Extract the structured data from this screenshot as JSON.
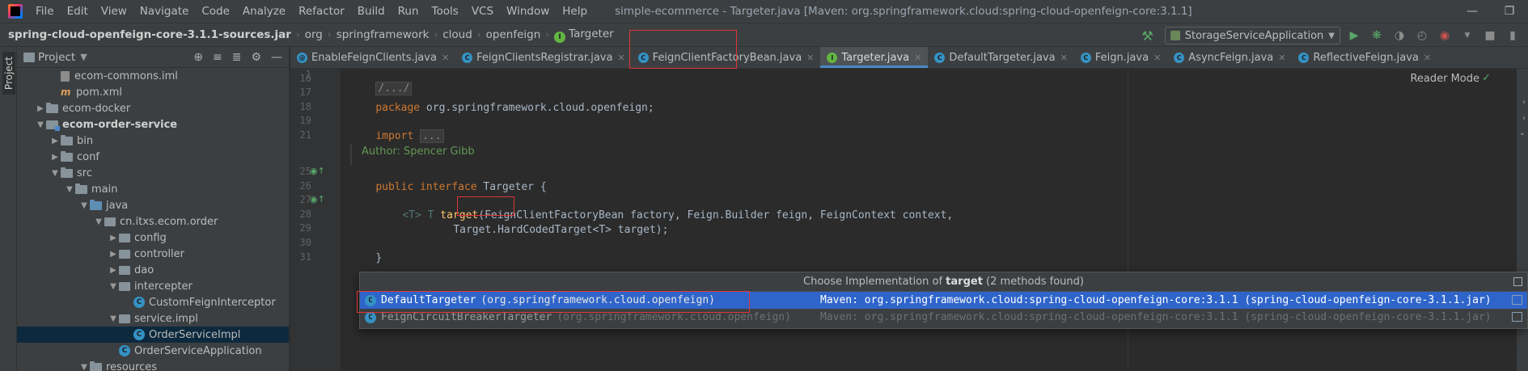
{
  "menubar": {
    "items": [
      "File",
      "Edit",
      "View",
      "Navigate",
      "Code",
      "Analyze",
      "Refactor",
      "Build",
      "Run",
      "Tools",
      "VCS",
      "Window",
      "Help"
    ],
    "window_title": "simple-ecommerce - Targeter.java [Maven: org.springframework.cloud:spring-cloud-openfeign-core:3.1.1]"
  },
  "navbar": {
    "breadcrumbs": [
      "spring-cloud-openfeign-core-3.1.1-sources.jar",
      "org",
      "springframework",
      "cloud",
      "openfeign",
      "Targeter"
    ],
    "run_config": "StorageServiceApplication"
  },
  "tool_strip": {
    "project_label": "Project"
  },
  "project_panel": {
    "title": "Project",
    "tree": [
      {
        "label": "ecom-commons.iml",
        "kind": "file",
        "indent": 2
      },
      {
        "label": "pom.xml",
        "kind": "xml",
        "indent": 2
      },
      {
        "label": "ecom-docker",
        "kind": "folder",
        "indent": 1,
        "arrow": "right"
      },
      {
        "label": "ecom-order-service",
        "kind": "module",
        "indent": 1,
        "arrow": "down",
        "bold": true
      },
      {
        "label": "bin",
        "kind": "folder",
        "indent": 2,
        "arrow": "right"
      },
      {
        "label": "conf",
        "kind": "folder",
        "indent": 2,
        "arrow": "right"
      },
      {
        "label": "src",
        "kind": "folder",
        "indent": 2,
        "arrow": "down"
      },
      {
        "label": "main",
        "kind": "folder",
        "indent": 3,
        "arrow": "down"
      },
      {
        "label": "java",
        "kind": "src",
        "indent": 4,
        "arrow": "down"
      },
      {
        "label": "cn.itxs.ecom.order",
        "kind": "pkg",
        "indent": 5,
        "arrow": "down"
      },
      {
        "label": "config",
        "kind": "pkg",
        "indent": 6,
        "arrow": "right"
      },
      {
        "label": "controller",
        "kind": "pkg",
        "indent": 6,
        "arrow": "right"
      },
      {
        "label": "dao",
        "kind": "pkg",
        "indent": 6,
        "arrow": "right"
      },
      {
        "label": "intercepter",
        "kind": "pkg",
        "indent": 6,
        "arrow": "down"
      },
      {
        "label": "CustomFeignInterceptor",
        "kind": "class",
        "indent": 7
      },
      {
        "label": "service.impl",
        "kind": "pkg",
        "indent": 6,
        "arrow": "down"
      },
      {
        "label": "OrderServiceImpl",
        "kind": "class",
        "indent": 7,
        "selected": true
      },
      {
        "label": "OrderServiceApplication",
        "kind": "appclass",
        "indent": 6
      },
      {
        "label": "resources",
        "kind": "folder",
        "indent": 4,
        "arrow": "down"
      }
    ]
  },
  "tabs": [
    {
      "label": "EnableFeignClients.java",
      "icon": "annotation"
    },
    {
      "label": "FeignClientsRegistrar.java",
      "icon": "class"
    },
    {
      "label": "FeignClientFactoryBean.java",
      "icon": "class"
    },
    {
      "label": "Targeter.java",
      "icon": "interface",
      "active": true
    },
    {
      "label": "DefaultTargeter.java",
      "icon": "class"
    },
    {
      "label": "Feign.java",
      "icon": "class"
    },
    {
      "label": "AsyncFeign.java",
      "icon": "class"
    },
    {
      "label": "ReflectiveFeign.java",
      "icon": "class"
    }
  ],
  "editor": {
    "reader_mode": "Reader Mode",
    "line_numbers": [
      "1",
      "16",
      "17",
      "18",
      "19",
      "21",
      "25",
      "26",
      "27",
      "28",
      "29",
      "30",
      "31"
    ],
    "fold_header": "/.../",
    "package_kw": "package",
    "package_name": " org.springframework.cloud.openfeign;",
    "import_kw": "import",
    "import_fold": "...",
    "author": "Author: Spencer Gibb",
    "iface_kw1": "public",
    "iface_kw2": "interface",
    "iface_name": "Targeter",
    "iface_brace": " {",
    "method_generic": "<T>",
    "method_ret": " T ",
    "method_name": "target",
    "method_params": "(FeignClientFactoryBean factory, Feign.Builder feign, FeignContext context,",
    "method_params2": "Target.HardCodedTarget<T> target);",
    "closing_brace": "}"
  },
  "popup": {
    "title_prefix": "Choose Implementation of ",
    "title_method": "target",
    "title_suffix": " (2 methods found)",
    "rows": [
      {
        "name": "DefaultTargeter",
        "pkg": "(org.springframework.cloud.openfeign)",
        "source": "Maven: org.springframework.cloud:spring-cloud-openfeign-core:3.1.1 (spring-cloud-openfeign-core-3.1.1.jar)",
        "selected": true
      },
      {
        "name": "FeignCircuitBreakerTargeter",
        "pkg": "(org.springframework.cloud.openfeign)",
        "source": "Maven: org.springframework.cloud:spring-cloud-openfeign-core:3.1.1 (spring-cloud-openfeign-core-3.1.1.jar)",
        "selected": false
      }
    ]
  },
  "colors": {
    "accent": "#2f65ca",
    "highlight_box": "#e0343a",
    "keyword": "#cc7832",
    "method": "#ffc66d"
  }
}
